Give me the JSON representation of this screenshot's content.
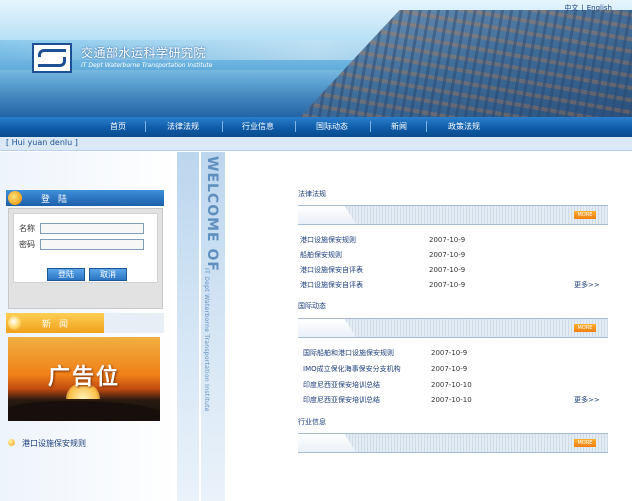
{
  "header": {
    "lang_zh": "中文",
    "lang_sep": "|",
    "lang_en": "English",
    "site_title": "交通部水运科学研究院",
    "site_subtitle": "IT Dept Waterborne Transportation Institute"
  },
  "nav": {
    "items": [
      "首页",
      "法律法规",
      "行业信息",
      "国际动态",
      "新闻",
      "政策法规"
    ]
  },
  "strip": {
    "text": "[    Hui yuan denlu    ]"
  },
  "login": {
    "title": "登陆",
    "name_label": "名称",
    "password_label": "密码",
    "submit_label": "登陆",
    "cancel_label": "取消"
  },
  "news": {
    "title": "新闻",
    "ad_text": "广告位",
    "items": [
      "港口设施保安规则"
    ]
  },
  "welcome": {
    "text": "WELCOME OF",
    "sub": "IT Dept Waterborne Transportation Institute"
  },
  "sections": [
    {
      "title": "法律法规",
      "more_badge": "MORE",
      "more_link": "更多>>",
      "articles": [
        {
          "title": "港口设施保安规则",
          "date": "2007-10-9"
        },
        {
          "title": "船舶保安规则",
          "date": "2007-10-9"
        },
        {
          "title": "港口设施保安自评表",
          "date": "2007-10-9"
        },
        {
          "title": "港口设施保安自评表",
          "date": "2007-10-9"
        }
      ]
    },
    {
      "title": "国际动态",
      "more_badge": "MORE",
      "more_link": "更多>>",
      "articles": [
        {
          "title": "国际船舶和港口设施保安规则",
          "date": "2007-10-9"
        },
        {
          "title": "IMO成立保化海事保安分支机构",
          "date": "2007-10-9"
        },
        {
          "title": "印度尼西亚保安培训总结",
          "date": "2007-10-10"
        },
        {
          "title": "印度尼西亚保安培训总结",
          "date": "2007-10-10"
        }
      ]
    },
    {
      "title": "行业信息",
      "more_badge": "MORE"
    }
  ],
  "colors": {
    "nav_blue": "#0f5ca8",
    "link_blue": "#1a3d7a",
    "news_orange": "#f0a019"
  }
}
